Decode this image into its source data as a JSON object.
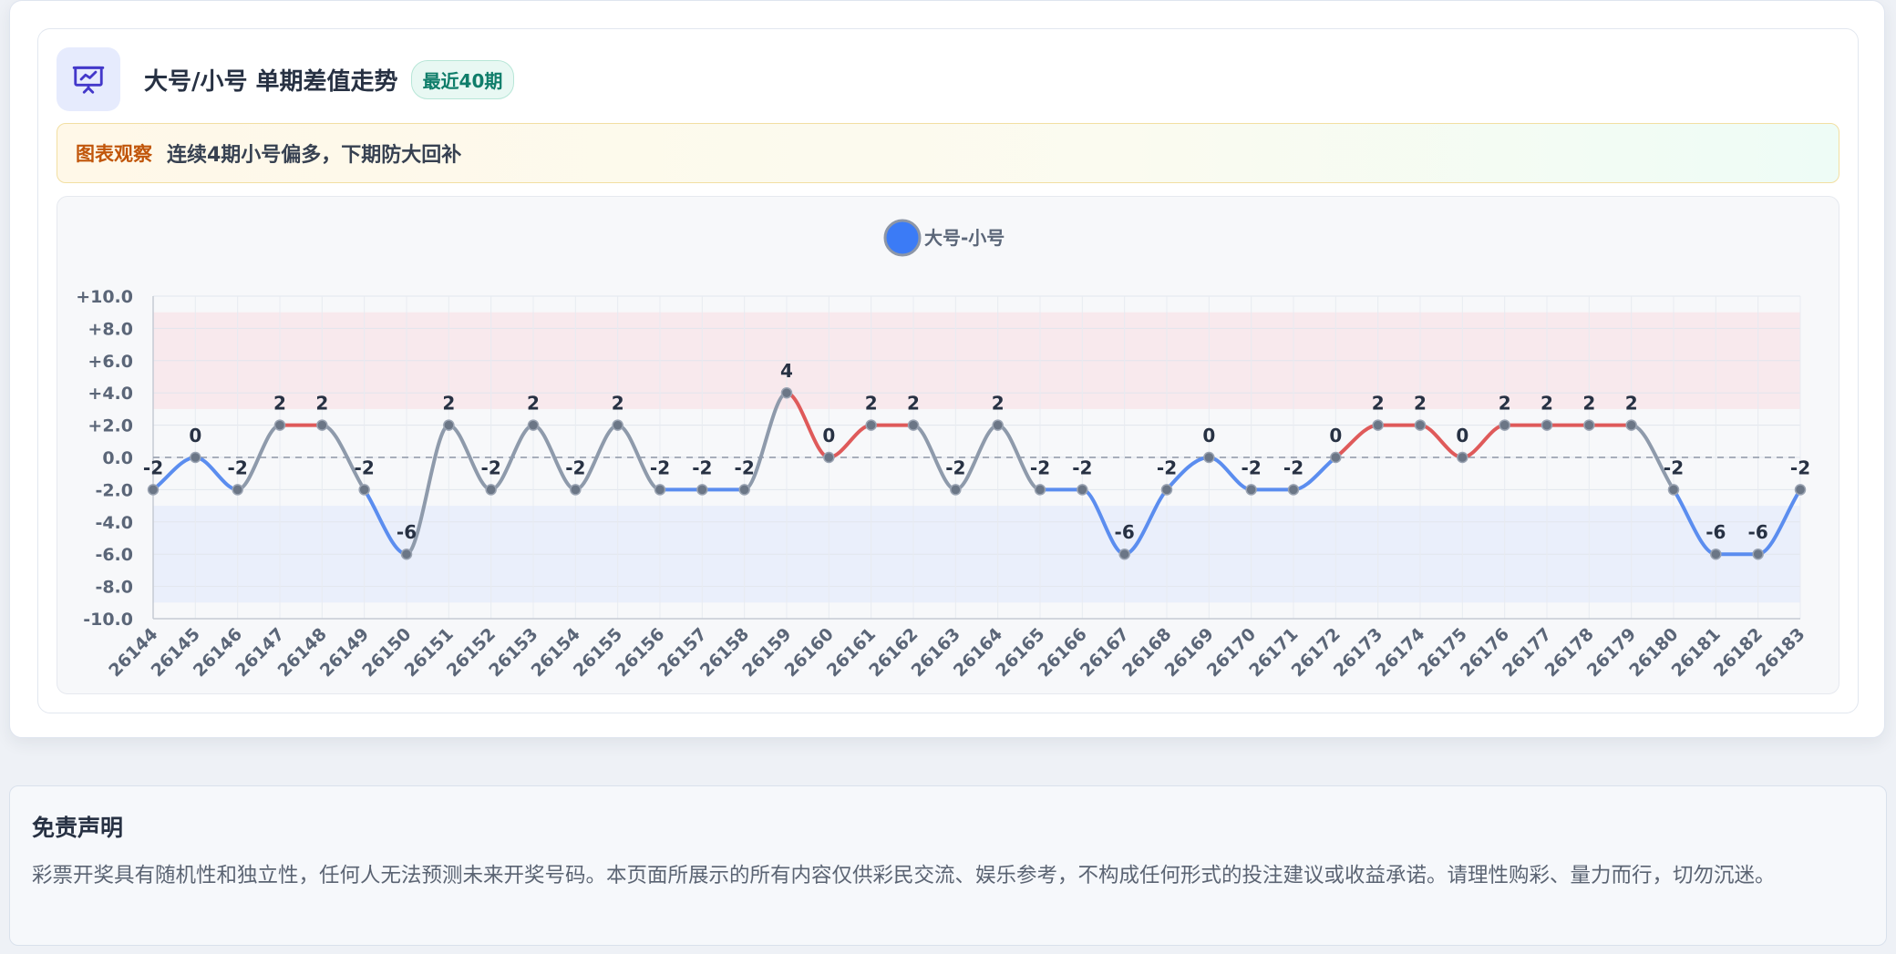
{
  "header": {
    "icon": "presentation-chart-icon",
    "title": "大号/小号 单期差值走势",
    "badge": "最近40期"
  },
  "notice": {
    "label": "图表观察",
    "text": "连续4期小号偏多，下期防大回补"
  },
  "colors": {
    "positive": "#df5a5a",
    "negative": "#5b8def",
    "neutral": "#8e9aab",
    "legend": "#3b7bf6",
    "upper_band": "#f8e8ec",
    "lower_band": "#e9eefb"
  },
  "chart_data": {
    "type": "line",
    "legend": {
      "label": "大号-小号",
      "position": "top-center"
    },
    "x": [
      "26144",
      "26145",
      "26146",
      "26147",
      "26148",
      "26149",
      "26150",
      "26151",
      "26152",
      "26153",
      "26154",
      "26155",
      "26156",
      "26157",
      "26158",
      "26159",
      "26160",
      "26161",
      "26162",
      "26163",
      "26164",
      "26165",
      "26166",
      "26167",
      "26168",
      "26169",
      "26170",
      "26171",
      "26172",
      "26173",
      "26174",
      "26175",
      "26176",
      "26177",
      "26178",
      "26179",
      "26180",
      "26181",
      "26182",
      "26183"
    ],
    "series": [
      {
        "name": "大号-小号",
        "values": [
          -2,
          0,
          -2,
          2,
          2,
          -2,
          -6,
          2,
          -2,
          2,
          -2,
          2,
          -2,
          -2,
          -2,
          4,
          0,
          2,
          2,
          -2,
          2,
          -2,
          -2,
          -6,
          -2,
          0,
          -2,
          -2,
          0,
          2,
          2,
          0,
          2,
          2,
          2,
          2,
          -2,
          -6,
          -6,
          -2
        ]
      }
    ],
    "ylim": [
      -10,
      10
    ],
    "yticks": [
      "+10.0",
      "+8.0",
      "+6.0",
      "+4.0",
      "+2.0",
      "0.0",
      "-2.0",
      "-4.0",
      "-6.0",
      "-8.0",
      "-10.0"
    ],
    "bands": [
      {
        "from": 3,
        "to": 9
      },
      {
        "from": -9,
        "to": -3
      }
    ],
    "reference_line": 0,
    "grid": true,
    "smooth": true
  },
  "disclaimer": {
    "title": "免责声明",
    "text": "彩票开奖具有随机性和独立性，任何人无法预测未来开奖号码。本页面所展示的所有内容仅供彩民交流、娱乐参考，不构成任何形式的投注建议或收益承诺。请理性购彩、量力而行，切勿沉迷。"
  }
}
